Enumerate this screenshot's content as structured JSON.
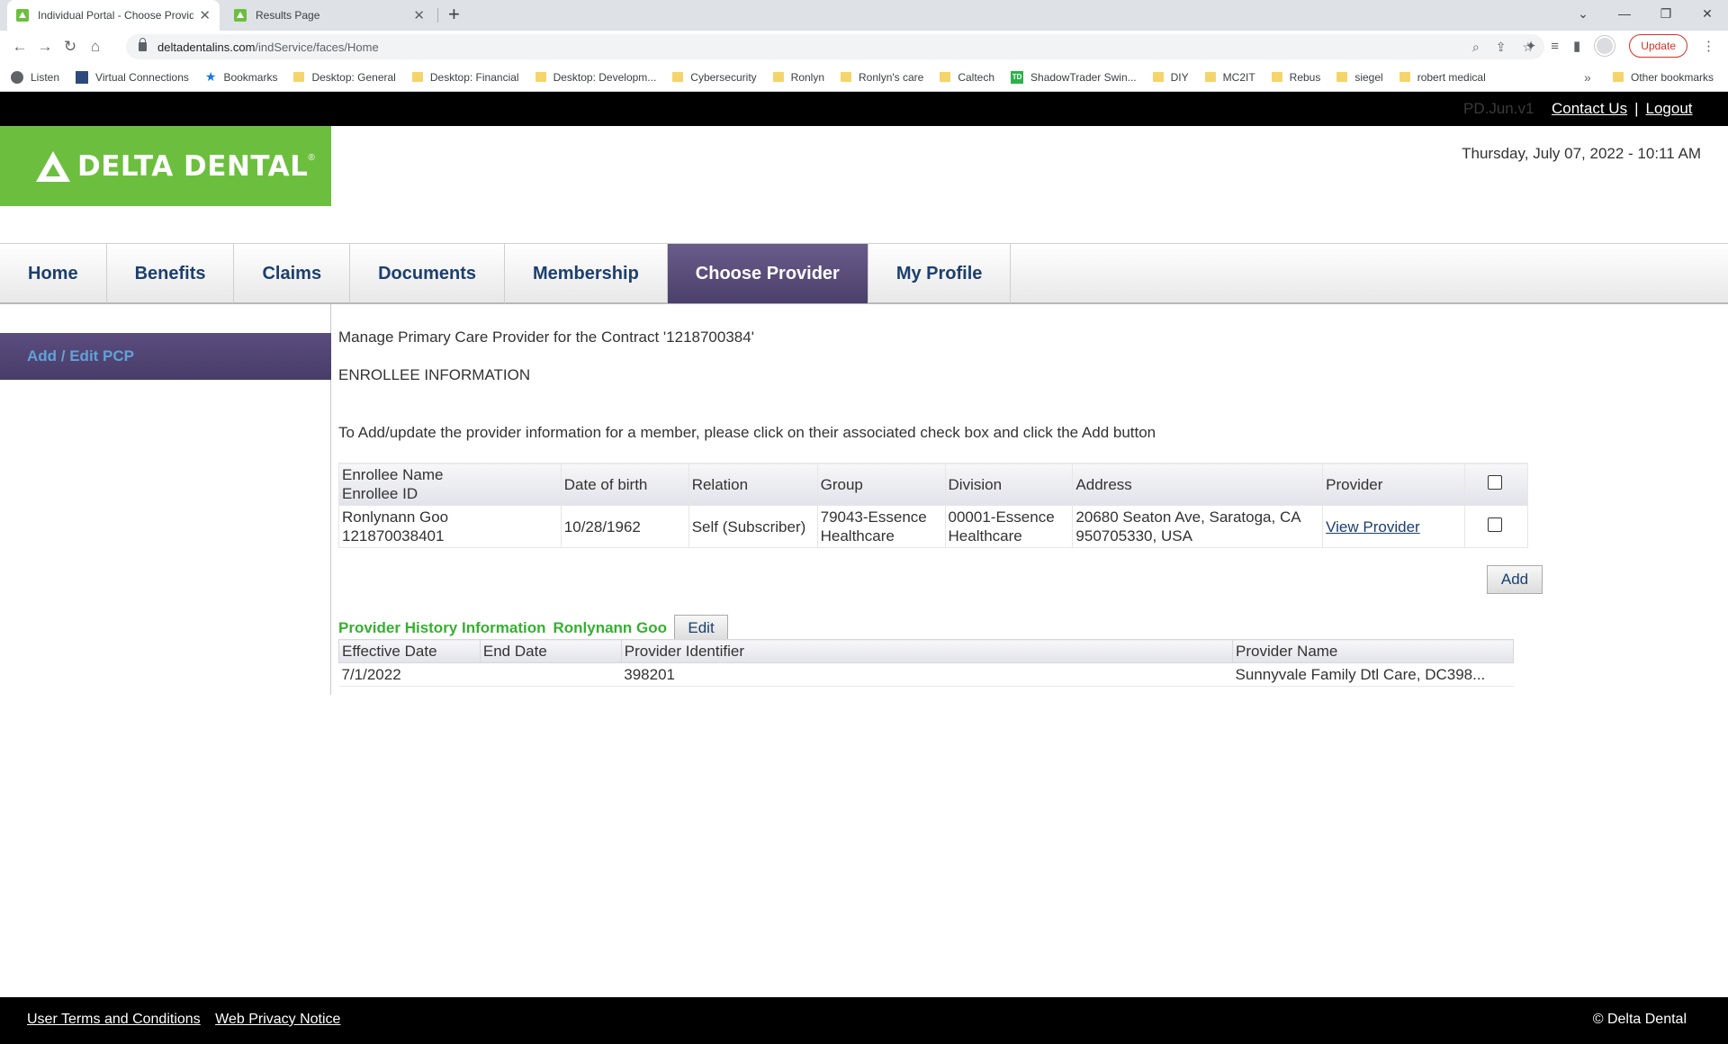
{
  "browser": {
    "tabs": [
      {
        "title": "Individual Portal - Choose Provid"
      },
      {
        "title": "Results Page"
      }
    ],
    "url_host": "deltadentalins.com",
    "url_path": "/indService/faces/Home",
    "update_label": "Update",
    "bookmarks": [
      "Listen",
      "Virtual Connections",
      "Bookmarks",
      "Desktop: General",
      "Desktop: Financial",
      "Desktop: Developm...",
      "Cybersecurity",
      "Ronlyn",
      "Ronlyn's care",
      "Caltech",
      "ShadowTrader Swin...",
      "DIY",
      "MC2IT",
      "Rebus",
      "siegel",
      "robert medical"
    ],
    "other_bookmarks": "Other bookmarks"
  },
  "topbar": {
    "version": "PD.Jun.v1",
    "contact_us": "Contact Us",
    "separator": "|",
    "logout": "Logout"
  },
  "header": {
    "brand": "DELTA DENTAL",
    "datetime": "Thursday, July 07, 2022 - 10:11 AM"
  },
  "nav": {
    "items": [
      "Home",
      "Benefits",
      "Claims",
      "Documents",
      "Membership",
      "Choose Provider",
      "My Profile"
    ],
    "active": "Choose Provider"
  },
  "sidebar": {
    "items": [
      {
        "label": "Add / Edit PCP"
      }
    ]
  },
  "main": {
    "manage_title": "Manage Primary Care Provider for the Contract '1218700384'",
    "section_title": "ENROLLEE INFORMATION",
    "instructions": "To Add/update the provider information for a member, please click on their associated check box and click the Add button",
    "enrollee_table": {
      "headers": {
        "name": "Enrollee Name",
        "id": "Enrollee ID",
        "dob": "Date of birth",
        "relation": "Relation",
        "group": "Group",
        "division": "Division",
        "address": "Address",
        "provider": "Provider"
      },
      "rows": [
        {
          "name": "Ronlynann Goo",
          "id": "121870038401",
          "dob": "10/28/1962",
          "relation": "Self (Subscriber)",
          "group_line1": "79043-Essence",
          "group_line2": "Healthcare",
          "division_line1": "00001-Essence",
          "division_line2": "Healthcare",
          "address_line1": "20680 Seaton Ave, Saratoga, CA",
          "address_line2": "950705330, USA",
          "provider_link": "View Provider"
        }
      ]
    },
    "add_button": "Add",
    "history": {
      "label": "Provider History Information",
      "member": "Ronlynann Goo",
      "edit_button": "Edit",
      "headers": {
        "effective": "Effective Date",
        "end": "End Date",
        "identifier": "Provider Identifier",
        "name": "Provider Name"
      },
      "rows": [
        {
          "effective": "7/1/2022",
          "end": "",
          "identifier": "398201",
          "name": "Sunnyvale Family Dtl Care, DC398..."
        }
      ]
    }
  },
  "footer": {
    "terms": "User Terms and Conditions",
    "privacy": "Web Privacy Notice",
    "copyright": "© Delta Dental"
  },
  "colors": {
    "brand_green": "#6cbf3e",
    "nav_active": "#4b3f6b",
    "nav_text": "#1c3f6e",
    "history_green": "#36b030"
  }
}
